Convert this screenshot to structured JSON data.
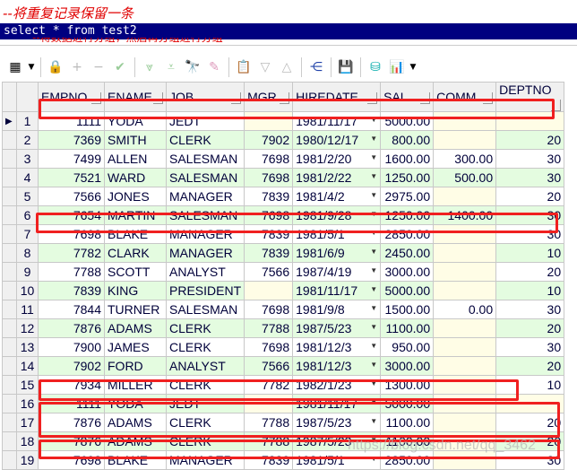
{
  "editor": {
    "comment_line": "--将重复记录保留一条",
    "selected_sql": "select * from test2",
    "partial_comment": "--将数据进行分组，然后再分组进行分组"
  },
  "toolbar": {
    "icons": [
      "grid-layout-icon",
      "dropdown-icon",
      "lock-icon",
      "add-record-icon",
      "delete-record-icon",
      "post-changes-icon",
      "next-page-icon",
      "last-page-icon",
      "find-icon",
      "clear-icon",
      "query-by-example-icon",
      "filter-icon",
      "sort-icon",
      "tree-icon",
      "save-icon",
      "export-icon",
      "chart-icon",
      "dropdown-icon"
    ]
  },
  "grid": {
    "columns": [
      "EMPNO",
      "ENAME",
      "JOB",
      "MGR",
      "HIREDATE",
      "SAL",
      "COMM",
      "DEPTNO"
    ],
    "current_row": 1,
    "rows": [
      [
        "1",
        "1111",
        "YODA",
        "JEDT",
        "",
        "1981/11/17",
        "5000.00",
        "",
        ""
      ],
      [
        "2",
        "7369",
        "SMITH",
        "CLERK",
        "7902",
        "1980/12/17",
        "800.00",
        "",
        "20"
      ],
      [
        "3",
        "7499",
        "ALLEN",
        "SALESMAN",
        "7698",
        "1981/2/20",
        "1600.00",
        "300.00",
        "30"
      ],
      [
        "4",
        "7521",
        "WARD",
        "SALESMAN",
        "7698",
        "1981/2/22",
        "1250.00",
        "500.00",
        "30"
      ],
      [
        "5",
        "7566",
        "JONES",
        "MANAGER",
        "7839",
        "1981/4/2",
        "2975.00",
        "",
        "20"
      ],
      [
        "6",
        "7654",
        "MARTIN",
        "SALESMAN",
        "7698",
        "1981/9/28",
        "1250.00",
        "1400.00",
        "30"
      ],
      [
        "7",
        "7698",
        "BLAKE",
        "MANAGER",
        "7839",
        "1981/5/1",
        "2850.00",
        "",
        "30"
      ],
      [
        "8",
        "7782",
        "CLARK",
        "MANAGER",
        "7839",
        "1981/6/9",
        "2450.00",
        "",
        "10"
      ],
      [
        "9",
        "7788",
        "SCOTT",
        "ANALYST",
        "7566",
        "1987/4/19",
        "3000.00",
        "",
        "20"
      ],
      [
        "10",
        "7839",
        "KING",
        "PRESIDENT",
        "",
        "1981/11/17",
        "5000.00",
        "",
        "10"
      ],
      [
        "11",
        "7844",
        "TURNER",
        "SALESMAN",
        "7698",
        "1981/9/8",
        "1500.00",
        "0.00",
        "30"
      ],
      [
        "12",
        "7876",
        "ADAMS",
        "CLERK",
        "7788",
        "1987/5/23",
        "1100.00",
        "",
        "20"
      ],
      [
        "13",
        "7900",
        "JAMES",
        "CLERK",
        "7698",
        "1981/12/3",
        "950.00",
        "",
        "30"
      ],
      [
        "14",
        "7902",
        "FORD",
        "ANALYST",
        "7566",
        "1981/12/3",
        "3000.00",
        "",
        "20"
      ],
      [
        "15",
        "7934",
        "MILLER",
        "CLERK",
        "7782",
        "1982/1/23",
        "1300.00",
        "",
        "10"
      ],
      [
        "16",
        "1111",
        "YODA",
        "JEDT",
        "",
        "1981/11/17",
        "5000.00",
        "",
        ""
      ],
      [
        "17",
        "7876",
        "ADAMS",
        "CLERK",
        "7788",
        "1987/5/23",
        "1100.00",
        "",
        "20"
      ],
      [
        "18",
        "7876",
        "ADAMS",
        "CLERK",
        "7788",
        "1987/5/23",
        "1100.00",
        "",
        "20"
      ],
      [
        "19",
        "7698",
        "BLAKE",
        "MANAGER",
        "7839",
        "1981/5/1",
        "2850.00",
        "",
        "30"
      ]
    ]
  },
  "highlight_color": "#f02020",
  "watermark": "https://blog.csdn.net/qq_3462"
}
